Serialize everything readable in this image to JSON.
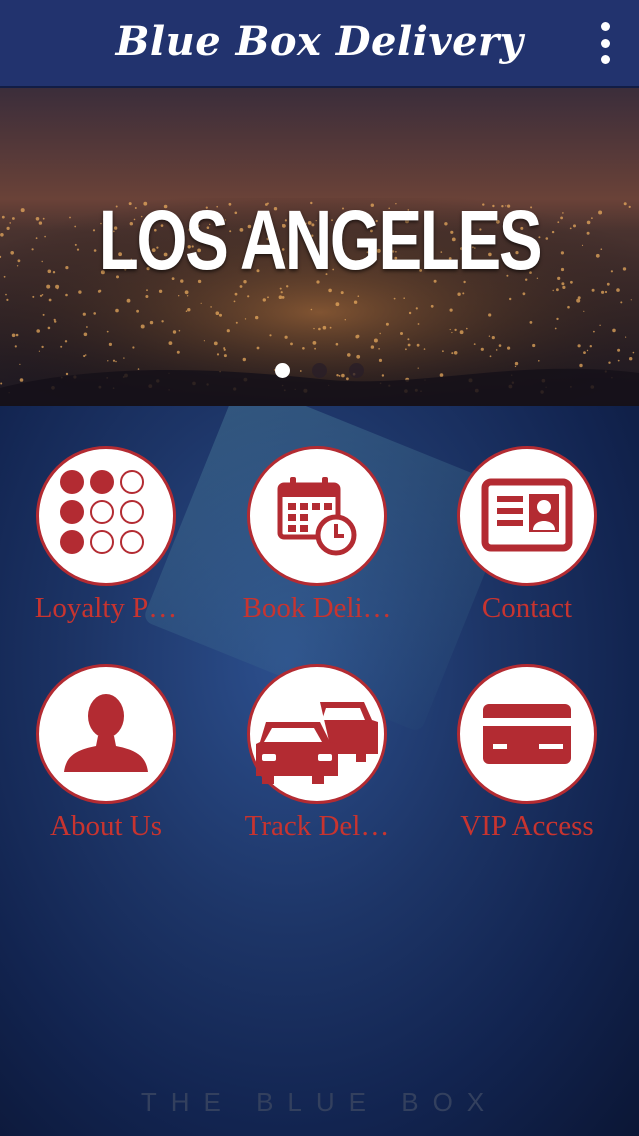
{
  "app_bar": {
    "title": "Blue Box Delivery",
    "menu_icon": "more-vert-icon"
  },
  "hero": {
    "title": "LOS ANGELES",
    "pager": {
      "count": 3,
      "active_index": 0
    }
  },
  "tiles": [
    {
      "label": "Loyalty P…",
      "icon": "loyalty-punch-card-icon"
    },
    {
      "label": "Book Deli…",
      "icon": "calendar-clock-icon"
    },
    {
      "label": "Contact",
      "icon": "contact-card-icon"
    },
    {
      "label": "About Us",
      "icon": "person-silhouette-icon"
    },
    {
      "label": "Track Del…",
      "icon": "cars-icon"
    },
    {
      "label": "VIP Access",
      "icon": "credit-card-icon"
    }
  ],
  "footer": {
    "brand": "THE BLUE BOX"
  },
  "colors": {
    "app_bar": "#22336e",
    "accent_red": "#b32b32",
    "label_red": "#c8342f"
  }
}
